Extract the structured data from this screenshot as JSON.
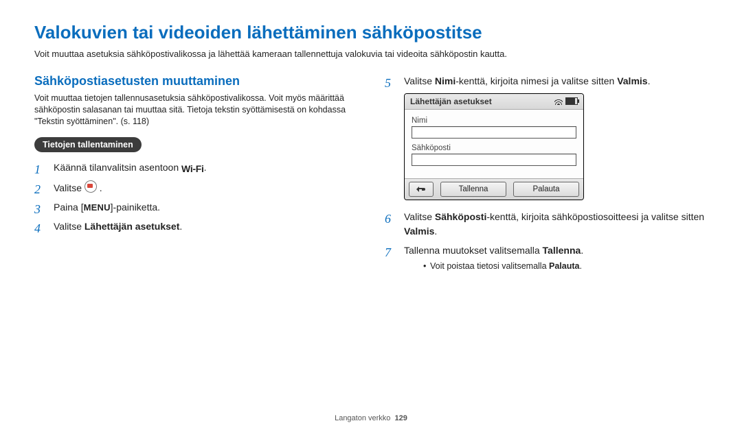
{
  "title": "Valokuvien tai videoiden lähettäminen sähköpostitse",
  "intro": "Voit muuttaa asetuksia sähköpostivalikossa ja lähettää kameraan tallennettuja valokuvia tai videoita sähköpostin kautta.",
  "left": {
    "subhead": "Sähköpostiasetusten muuttaminen",
    "subdesc": "Voit muuttaa tietojen tallennusasetuksia sähköpostivalikossa. Voit myös määrittää sähköpostin salasanan tai muuttaa sitä. Tietoja tekstin syöttämisestä on kohdassa \"Tekstin syöttäminen\". (s. 118)",
    "pill": "Tietojen tallentaminen",
    "steps": {
      "s1_pre": "Käännä tilanvalitsin asentoon ",
      "s1_wifi": "Wi-Fi",
      "s1_post": ".",
      "s2_pre": "Valitse ",
      "s2_post": " .",
      "s3_pre": "Paina [",
      "s3_menu": "MENU",
      "s3_post": "]-painiketta.",
      "s4_pre": "Valitse ",
      "s4_bold": "Lähettäjän asetukset",
      "s4_post": "."
    }
  },
  "right": {
    "steps": {
      "s5_pre": "Valitse ",
      "s5_b1": "Nimi",
      "s5_mid": "-kenttä, kirjoita nimesi ja valitse sitten ",
      "s5_b2": "Valmis",
      "s5_post": ".",
      "s6_pre": "Valitse ",
      "s6_b1": "Sähköposti",
      "s6_mid": "-kenttä, kirjoita sähköpostiosoitteesi ja valitse sitten ",
      "s6_b2": "Valmis",
      "s6_post": ".",
      "s7_pre": "Tallenna muutokset valitsemalla ",
      "s7_b1": "Tallenna",
      "s7_post": ".",
      "s7_note_pre": "Voit poistaa tietosi valitsemalla ",
      "s7_note_b": "Palauta",
      "s7_note_post": "."
    }
  },
  "device": {
    "header": "Lähettäjän asetukset",
    "label_name": "Nimi",
    "label_email": "Sähköposti",
    "btn_save": "Tallenna",
    "btn_reset": "Palauta"
  },
  "footer": {
    "section": "Langaton verkko",
    "page": "129"
  }
}
